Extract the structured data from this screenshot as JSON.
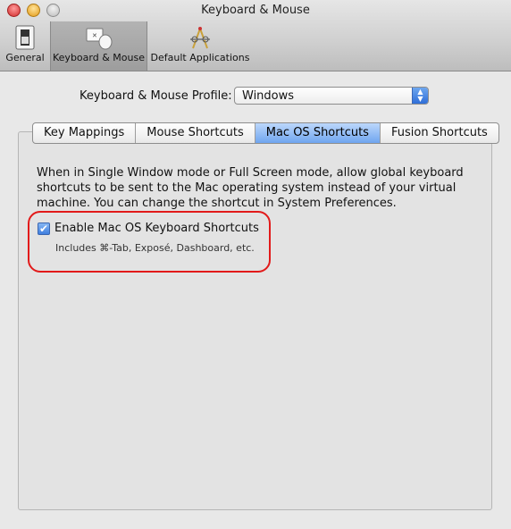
{
  "window": {
    "title": "Keyboard & Mouse"
  },
  "toolbar": {
    "items": [
      {
        "label": "General",
        "icon": "general-switch-icon"
      },
      {
        "label": "Keyboard & Mouse",
        "icon": "keyboard-mouse-icon",
        "selected": true
      },
      {
        "label": "Default Applications",
        "icon": "default-applications-icon"
      }
    ]
  },
  "profile": {
    "label": "Keyboard & Mouse Profile:",
    "value": "Windows"
  },
  "tabs": [
    {
      "label": "Key Mappings"
    },
    {
      "label": "Mouse Shortcuts"
    },
    {
      "label": "Mac OS Shortcuts",
      "active": true
    },
    {
      "label": "Fusion Shortcuts"
    }
  ],
  "content": {
    "description": "When in Single Window mode or Full Screen mode, allow global keyboard shortcuts to be sent to the Mac operating system instead of your virtual machine. You can change the shortcut in System Preferences.",
    "checkbox_label": "Enable Mac OS Keyboard Shortcuts",
    "checkbox_checked": true,
    "sub_label": "Includes ⌘-Tab, Exposé, Dashboard, etc."
  },
  "colors": {
    "highlight": "#e21a1a",
    "accent": "#3f7fdf"
  }
}
